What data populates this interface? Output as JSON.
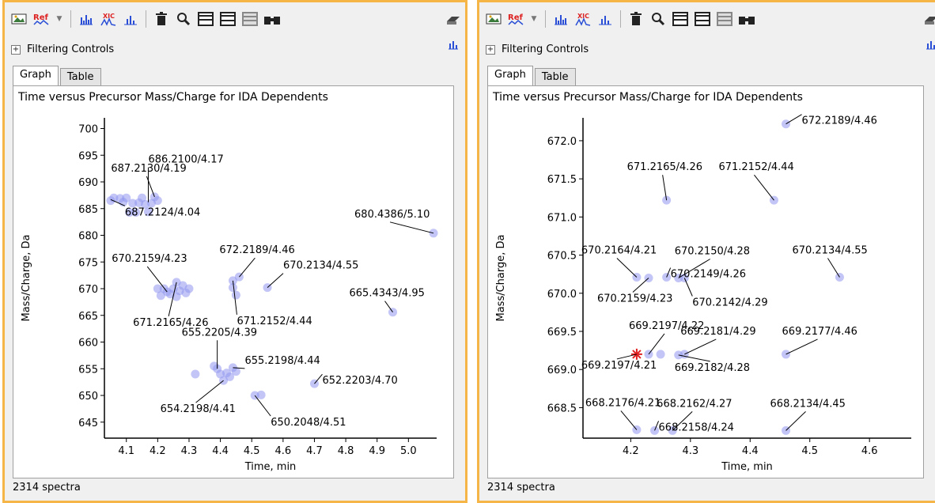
{
  "panels": [
    {
      "toolbar": {
        "ref_label": "Ref",
        "xic_label": "XIC"
      },
      "filtering_label": "Filtering Controls",
      "tabs": [
        "Graph",
        "Table"
      ],
      "graph_title": "Time versus Precursor Mass/Charge for IDA Dependents",
      "status": "2314 spectra"
    },
    {
      "toolbar": {
        "ref_label": "Ref",
        "xic_label": "XIC"
      },
      "filtering_label": "Filtering Controls",
      "tabs": [
        "Graph",
        "Table"
      ],
      "graph_title": "Time versus Precursor Mass/Charge for IDA Dependents",
      "status": "2314 spectra"
    }
  ],
  "colors": {
    "point": "#8f95ee",
    "selected": "#e02020",
    "panel_border": "#f5b547"
  },
  "chart_data": [
    {
      "type": "scatter",
      "title": "Time versus Precursor Mass/Charge for IDA Dependents",
      "xlabel": "Time, min",
      "ylabel": "Mass/Charge, Da",
      "xlim": [
        4.03,
        5.09
      ],
      "ylim": [
        642,
        702
      ],
      "xticks": [
        "4.1",
        "4.2",
        "4.3",
        "4.4",
        "4.5",
        "4.6",
        "4.7",
        "4.8",
        "4.9",
        "5.0"
      ],
      "yticks": [
        "645",
        "650",
        "655",
        "660",
        "665",
        "670",
        "675",
        "680",
        "685",
        "690",
        "695",
        "700"
      ],
      "points": [
        [
          4.05,
          686.5
        ],
        [
          4.06,
          687
        ],
        [
          4.08,
          686.9
        ],
        [
          4.09,
          686.2
        ],
        [
          4.1,
          687
        ],
        [
          4.11,
          684.3
        ],
        [
          4.12,
          686
        ],
        [
          4.13,
          684.3
        ],
        [
          4.14,
          686.1
        ],
        [
          4.15,
          687
        ],
        [
          4.16,
          685.8
        ],
        [
          4.17,
          684.4
        ],
        [
          4.18,
          686
        ],
        [
          4.19,
          687.2
        ],
        [
          4.2,
          686.5
        ],
        [
          4.2,
          670
        ],
        [
          4.21,
          668.7
        ],
        [
          4.22,
          670
        ],
        [
          4.23,
          669.4
        ],
        [
          4.24,
          669
        ],
        [
          4.25,
          670
        ],
        [
          4.26,
          671.2
        ],
        [
          4.26,
          668.5
        ],
        [
          4.27,
          669.6
        ],
        [
          4.28,
          670.6
        ],
        [
          4.29,
          669.2
        ],
        [
          4.3,
          670
        ],
        [
          4.44,
          671.5
        ],
        [
          4.44,
          670.2
        ],
        [
          4.45,
          668.8
        ],
        [
          4.46,
          672.2
        ],
        [
          4.55,
          670.2
        ],
        [
          4.32,
          654
        ],
        [
          4.38,
          655.5
        ],
        [
          4.39,
          655
        ],
        [
          4.4,
          654
        ],
        [
          4.41,
          652.8
        ],
        [
          4.42,
          654.2
        ],
        [
          4.43,
          653.5
        ],
        [
          4.44,
          655.2
        ],
        [
          4.45,
          654.5
        ],
        [
          4.51,
          650
        ],
        [
          4.53,
          650.1
        ],
        [
          4.7,
          652.2
        ],
        [
          4.95,
          665.6
        ],
        [
          5.08,
          680.4
        ]
      ],
      "labels": [
        {
          "text": "687.2130/4.19",
          "x": 4.19,
          "y": 687.2
        },
        {
          "text": "686.2100/4.17",
          "x": 4.17,
          "y": 686.2
        },
        {
          "text": "687.2124/4.04",
          "x": 4.05,
          "y": 686.7
        },
        {
          "text": "680.4386/5.10",
          "x": 5.08,
          "y": 680.4
        },
        {
          "text": "670.2159/4.23",
          "x": 4.23,
          "y": 669.4
        },
        {
          "text": "672.2189/4.46",
          "x": 4.46,
          "y": 672.2
        },
        {
          "text": "670.2134/4.55",
          "x": 4.55,
          "y": 670.2
        },
        {
          "text": "665.4343/4.95",
          "x": 4.95,
          "y": 665.6
        },
        {
          "text": "671.2165/4.26",
          "x": 4.26,
          "y": 671.2
        },
        {
          "text": "671.2152/4.44",
          "x": 4.44,
          "y": 671.5
        },
        {
          "text": "655.2205/4.39",
          "x": 4.39,
          "y": 655
        },
        {
          "text": "655.2198/4.44",
          "x": 4.44,
          "y": 655.2
        },
        {
          "text": "652.2203/4.70",
          "x": 4.7,
          "y": 652.2
        },
        {
          "text": "654.2198/4.41",
          "x": 4.41,
          "y": 652.8
        },
        {
          "text": "650.2048/4.51",
          "x": 4.51,
          "y": 650
        }
      ]
    },
    {
      "type": "scatter",
      "title": "Time versus Precursor Mass/Charge for IDA Dependents",
      "xlabel": "Time, min",
      "ylabel": "Mass/Charge, Da",
      "xlim": [
        4.12,
        4.67
      ],
      "ylim": [
        668.1,
        672.3
      ],
      "xticks": [
        "4.2",
        "4.3",
        "4.4",
        "4.5",
        "4.6"
      ],
      "yticks": [
        "668.5",
        "669.0",
        "669.5",
        "670.0",
        "670.5",
        "671.0",
        "671.5",
        "672.0"
      ],
      "points": [
        [
          4.46,
          672.22
        ],
        [
          4.26,
          671.22
        ],
        [
          4.44,
          671.22
        ],
        [
          4.21,
          670.21
        ],
        [
          4.23,
          670.2
        ],
        [
          4.26,
          670.21
        ],
        [
          4.28,
          670.2
        ],
        [
          4.29,
          670.2
        ],
        [
          4.55,
          670.21
        ],
        [
          4.23,
          669.2
        ],
        [
          4.25,
          669.2
        ],
        [
          4.28,
          669.19
        ],
        [
          4.29,
          669.2
        ],
        [
          4.46,
          669.2
        ],
        [
          4.21,
          668.21
        ],
        [
          4.24,
          668.2
        ],
        [
          4.27,
          668.2
        ],
        [
          4.46,
          668.2
        ]
      ],
      "selected": [
        4.21,
        669.2
      ],
      "labels": [
        {
          "text": "672.2189/4.46",
          "x": 4.46,
          "y": 672.22
        },
        {
          "text": "671.2165/4.26",
          "x": 4.26,
          "y": 671.22
        },
        {
          "text": "671.2152/4.44",
          "x": 4.44,
          "y": 671.22
        },
        {
          "text": "670.2164/4.21",
          "x": 4.21,
          "y": 670.21
        },
        {
          "text": "670.2150/4.28",
          "x": 4.28,
          "y": 670.2
        },
        {
          "text": "670.2134/4.55",
          "x": 4.55,
          "y": 670.21
        },
        {
          "text": "670.2149/4.26",
          "x": 4.26,
          "y": 670.21
        },
        {
          "text": "670.2159/4.23",
          "x": 4.23,
          "y": 670.2
        },
        {
          "text": "670.2142/4.29",
          "x": 4.29,
          "y": 670.2
        },
        {
          "text": "669.2197/4.22",
          "x": 4.23,
          "y": 669.2
        },
        {
          "text": "669.2181/4.29",
          "x": 4.29,
          "y": 669.2
        },
        {
          "text": "669.2177/4.46",
          "x": 4.46,
          "y": 669.2
        },
        {
          "text": "669.2197/4.21",
          "x": 4.21,
          "y": 669.2
        },
        {
          "text": "669.2182/4.28",
          "x": 4.28,
          "y": 669.19
        },
        {
          "text": "668.2176/4.21",
          "x": 4.21,
          "y": 668.21
        },
        {
          "text": "668.2162/4.27",
          "x": 4.27,
          "y": 668.2
        },
        {
          "text": "668.2134/4.45",
          "x": 4.46,
          "y": 668.2
        },
        {
          "text": "668.2158/4.24",
          "x": 4.24,
          "y": 668.2
        }
      ]
    }
  ]
}
